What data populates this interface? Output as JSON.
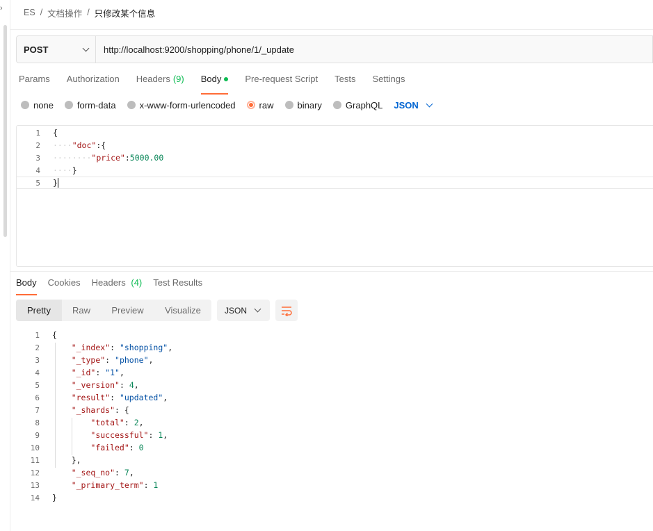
{
  "breadcrumb": {
    "items": [
      "ES",
      "文档操作"
    ],
    "current": "只修改某个信息"
  },
  "request": {
    "method": "POST",
    "url": "http://localhost:9200/shopping/phone/1/_update"
  },
  "request_tabs": {
    "params": "Params",
    "authorization": "Authorization",
    "headers": "Headers",
    "headers_count": "(9)",
    "body": "Body",
    "prerequest": "Pre-request Script",
    "tests": "Tests",
    "settings": "Settings",
    "active": "Body"
  },
  "body_types": {
    "none": "none",
    "form_data": "form-data",
    "urlencoded": "x-www-form-urlencoded",
    "raw": "raw",
    "binary": "binary",
    "graphql": "GraphQL",
    "selected": "raw",
    "format": "JSON"
  },
  "request_body": {
    "line_numbers": [
      "1",
      "2",
      "3",
      "4",
      "5"
    ],
    "l1": "{",
    "l2_key": "\"doc\"",
    "l2_rest": ":{",
    "l3_key": "\"price\"",
    "l3_colon": ":",
    "l3_val": "5000.00",
    "l4": "}",
    "l5": "}"
  },
  "response_tabs": {
    "body": "Body",
    "cookies": "Cookies",
    "headers": "Headers",
    "headers_count": "(4)",
    "test_results": "Test Results",
    "active": "Body"
  },
  "response_view": {
    "pretty": "Pretty",
    "raw": "Raw",
    "preview": "Preview",
    "visualize": "Visualize",
    "active": "Pretty",
    "language": "JSON"
  },
  "response_body": {
    "line_numbers": [
      "1",
      "2",
      "3",
      "4",
      "5",
      "6",
      "7",
      "8",
      "9",
      "10",
      "11",
      "12",
      "13",
      "14"
    ],
    "open": "{",
    "index_key": "\"_index\"",
    "index_val": "\"shopping\"",
    "type_key": "\"_type\"",
    "type_val": "\"phone\"",
    "id_key": "\"_id\"",
    "id_val": "\"1\"",
    "version_key": "\"_version\"",
    "version_val": "4",
    "result_key": "\"result\"",
    "result_val": "\"updated\"",
    "shards_key": "\"_shards\"",
    "shards_open": "{",
    "total_key": "\"total\"",
    "total_val": "2",
    "successful_key": "\"successful\"",
    "successful_val": "1",
    "failed_key": "\"failed\"",
    "failed_val": "0",
    "shards_close": "},",
    "seq_key": "\"_seq_no\"",
    "seq_val": "7",
    "term_key": "\"_primary_term\"",
    "term_val": "1",
    "close": "}"
  }
}
